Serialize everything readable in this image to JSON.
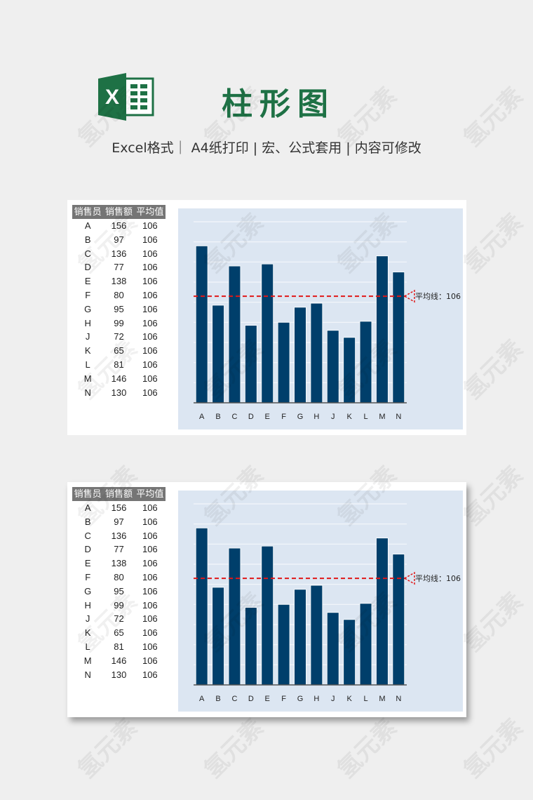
{
  "header": {
    "logo_icon": "excel-logo-icon",
    "logo_letter": "X",
    "title": "柱形图",
    "subtitle": "Excel格式｜ A4纸打印 | 宏、公式套用 | 内容可修改"
  },
  "watermark": "氢元素",
  "colors": {
    "brand_green": "#1e7145",
    "bar": "#003f6b",
    "avg_line": "#e01818",
    "plot_bg": "#dce6f2",
    "table_header": "#757575"
  },
  "table": {
    "headers": [
      "销售员",
      "销售额",
      "平均值"
    ],
    "rows": [
      [
        "A",
        "156",
        "106"
      ],
      [
        "B",
        "97",
        "106"
      ],
      [
        "C",
        "136",
        "106"
      ],
      [
        "D",
        "77",
        "106"
      ],
      [
        "E",
        "138",
        "106"
      ],
      [
        "F",
        "80",
        "106"
      ],
      [
        "G",
        "95",
        "106"
      ],
      [
        "H",
        "99",
        "106"
      ],
      [
        "J",
        "72",
        "106"
      ],
      [
        "K",
        "65",
        "106"
      ],
      [
        "L",
        "81",
        "106"
      ],
      [
        "M",
        "146",
        "106"
      ],
      [
        "N",
        "130",
        "106"
      ]
    ]
  },
  "chart_data": [
    {
      "type": "bar",
      "title": "",
      "xlabel": "",
      "ylabel": "",
      "categories": [
        "A",
        "B",
        "C",
        "D",
        "E",
        "F",
        "G",
        "H",
        "J",
        "K",
        "L",
        "M",
        "N"
      ],
      "series": [
        {
          "name": "销售额",
          "values": [
            156,
            97,
            136,
            77,
            138,
            80,
            95,
            99,
            72,
            65,
            81,
            146,
            130
          ]
        },
        {
          "name": "平均值",
          "type": "line",
          "values": [
            106,
            106,
            106,
            106,
            106,
            106,
            106,
            106,
            106,
            106,
            106,
            106,
            106
          ]
        }
      ],
      "ylim": [
        0,
        180
      ],
      "ytick_step": 20,
      "grid": true,
      "yaxis_labels_visible": false,
      "annotation": {
        "label": "平均线：106",
        "value": 106
      }
    },
    {
      "type": "bar",
      "title": "",
      "xlabel": "",
      "ylabel": "",
      "categories": [
        "A",
        "B",
        "C",
        "D",
        "E",
        "F",
        "G",
        "H",
        "J",
        "K",
        "L",
        "M",
        "N"
      ],
      "series": [
        {
          "name": "销售额",
          "values": [
            156,
            97,
            136,
            77,
            138,
            80,
            95,
            99,
            72,
            65,
            81,
            146,
            130
          ]
        },
        {
          "name": "平均值",
          "type": "line",
          "values": [
            106,
            106,
            106,
            106,
            106,
            106,
            106,
            106,
            106,
            106,
            106,
            106,
            106
          ]
        }
      ],
      "ylim": [
        0,
        180
      ],
      "ytick_step": 20,
      "grid": true,
      "yaxis_labels_visible": false,
      "annotation": {
        "label": "平均线：106",
        "value": 106
      }
    }
  ]
}
